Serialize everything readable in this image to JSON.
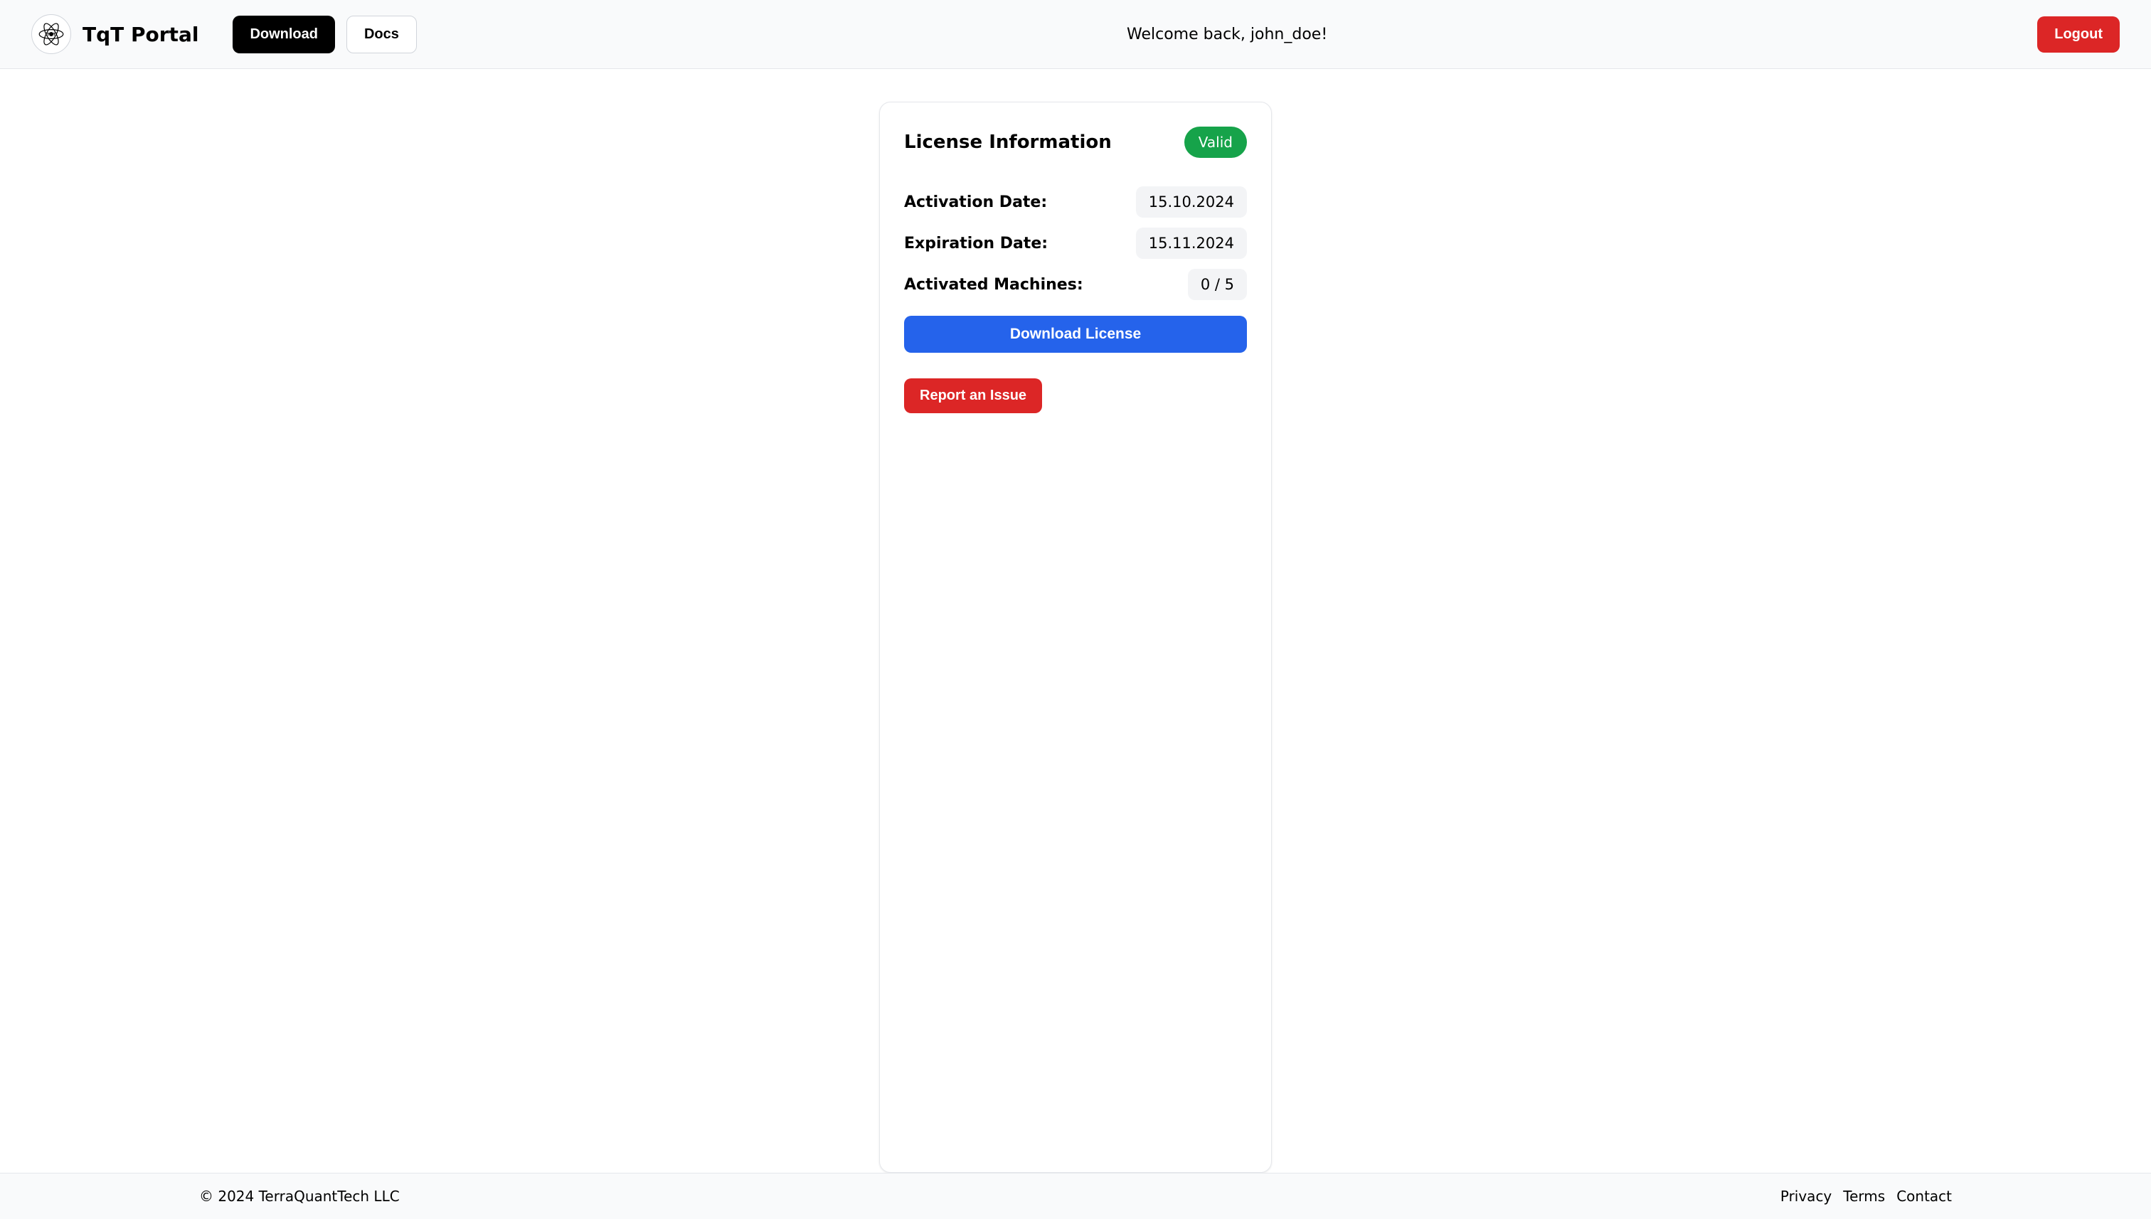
{
  "header": {
    "brand_name": "TqT Portal",
    "download_label": "Download",
    "docs_label": "Docs",
    "welcome_text": "Welcome back, john_doe!",
    "logout_label": "Logout"
  },
  "card": {
    "title": "License Information",
    "status_badge": "Valid",
    "rows": [
      {
        "label": "Activation Date:",
        "value": "15.10.2024"
      },
      {
        "label": "Expiration Date:",
        "value": "15.11.2024"
      },
      {
        "label": "Activated Machines:",
        "value": "0 / 5"
      }
    ],
    "download_license_label": "Download License",
    "report_issue_label": "Report an Issue"
  },
  "footer": {
    "copyright": "© 2024 TerraQuantTech LLC",
    "links": {
      "privacy": "Privacy",
      "terms": "Terms",
      "contact": "Contact"
    }
  },
  "colors": {
    "green": "#16a34a",
    "blue": "#2563eb",
    "red": "#dc2626"
  }
}
